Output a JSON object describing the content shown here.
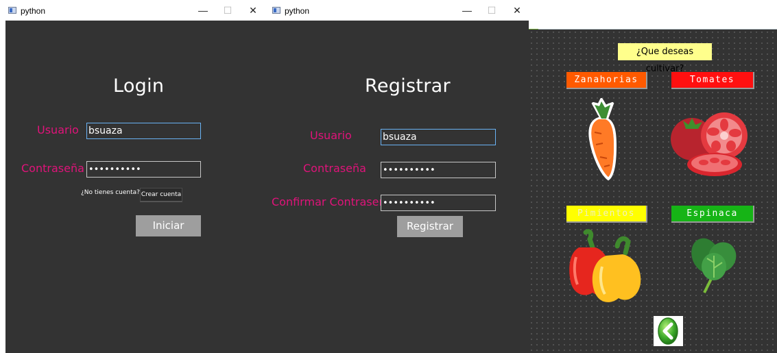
{
  "windows": {
    "login": {
      "title": "python",
      "heading": "Login",
      "username_label": "Usuario",
      "username_value": "bsuaza",
      "password_label": "Contraseña",
      "password_value": "••••••••••",
      "no_account_text": "¿No tienes cuenta?",
      "create_account_button": "Crear cuenta",
      "login_button": "Iniciar"
    },
    "register": {
      "title": "python",
      "heading": "Registrar",
      "username_label": "Usuario",
      "username_value": "bsuaza",
      "password_label": "Contraseña",
      "password_value": "••••••••••",
      "confirm_label": "Confirmar Contraseña",
      "confirm_value": "••••••••••",
      "register_button": "Registrar"
    },
    "titlebar_buttons": {
      "minimize": "—",
      "maximize": "☐",
      "close": "✕"
    },
    "crops": {
      "question": "¿Que deseas cultivar?",
      "items": [
        {
          "label": "Zanahorias",
          "color": "#ff5a00",
          "image": "carrot-image"
        },
        {
          "label": "Tomates",
          "color": "#ff1010",
          "image": "tomato-image"
        },
        {
          "label": "Pimientos",
          "color": "#ffff00",
          "image": "pepper-image"
        },
        {
          "label": "Espinaca",
          "color": "#16b416",
          "image": "spinach-image"
        }
      ],
      "back_icon": "back-arrow-icon"
    }
  }
}
